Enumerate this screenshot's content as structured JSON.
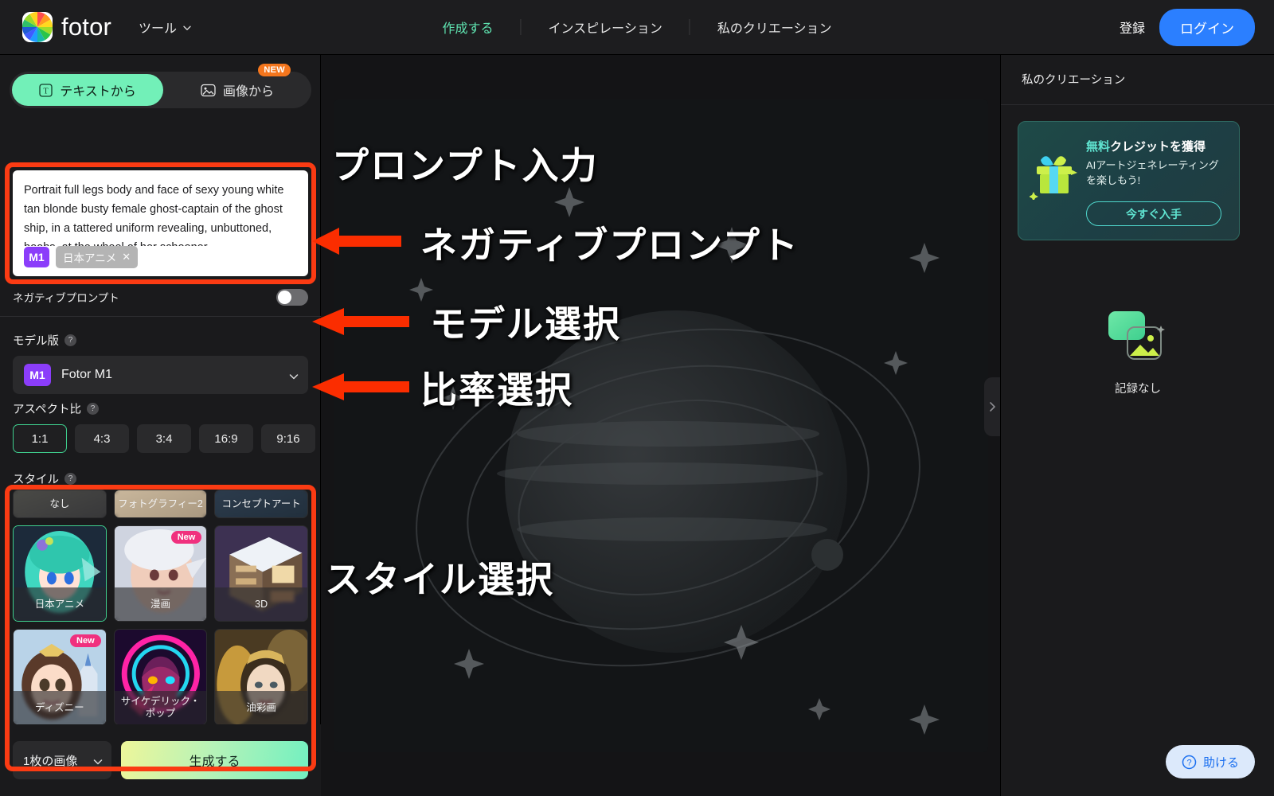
{
  "header": {
    "brand": "fotor",
    "tools_label": "ツール",
    "nav": [
      {
        "label": "作成する",
        "active": true
      },
      {
        "label": "インスピレーション",
        "active": false
      },
      {
        "label": "私のクリエーション",
        "active": false
      }
    ],
    "signup_label": "登録",
    "login_label": "ログイン",
    "login_color": "#2b7fff"
  },
  "left_panel": {
    "tabs": [
      {
        "label": "テキストから",
        "icon": "text-icon",
        "active": true
      },
      {
        "label": "画像から",
        "icon": "image-icon",
        "active": false,
        "badge": "NEW"
      }
    ],
    "prompt": {
      "value": "Portrait full legs body and face of sexy young white tan blonde busty female ghost-captain of the ghost ship, in a tattered uniform revealing, unbuttoned, boobs, at the wheel of her schooner",
      "model_chip": "M1",
      "style_chip": "日本アニメ",
      "style_chip_remove": "✕"
    },
    "negative_prompt": {
      "label": "ネガティブプロンプト",
      "enabled": false
    },
    "model": {
      "section_label": "モデル版",
      "badge": "M1",
      "selected": "Fotor M1"
    },
    "aspect_ratio": {
      "section_label": "アスペクト比",
      "options": [
        "1:1",
        "4:3",
        "3:4",
        "16:9",
        "9:16"
      ],
      "selected": "1:1"
    },
    "style": {
      "section_label": "スタイル",
      "selected": "日本アニメ",
      "partial_top_row": [
        {
          "label": "なし"
        },
        {
          "label": "フォトグラフィー2"
        },
        {
          "label": "コンセプトアート"
        }
      ],
      "cards": [
        {
          "label": "日本アニメ",
          "selected": true,
          "badge": ""
        },
        {
          "label": "漫画",
          "selected": false,
          "badge": "New"
        },
        {
          "label": "3D",
          "selected": false,
          "badge": ""
        },
        {
          "label": "ディズニー",
          "selected": false,
          "badge": "New"
        },
        {
          "label": "サイケデリック・ポップ",
          "selected": false,
          "badge": ""
        },
        {
          "label": "油彩画",
          "selected": false,
          "badge": ""
        }
      ]
    },
    "footer": {
      "count_label": "1枚の画像",
      "generate_label": "生成する"
    }
  },
  "annotations": {
    "highlight_color": "#fb3b13",
    "labels": [
      "プロンプト入力",
      "ネガティブプロンプト",
      "モデル選択",
      "比率選択",
      "スタイル選択"
    ]
  },
  "right_panel": {
    "title": "私のクリエーション",
    "promo": {
      "title_highlight": "無料",
      "title_rest": "クレジットを獲得",
      "body": "AIアートジェネレーティングを楽しもう!",
      "button": "今すぐ入手",
      "accent": "#5fe3d0"
    },
    "empty_state": "記録なし"
  },
  "help": {
    "label": "助ける",
    "icon": "question-circle-icon"
  }
}
